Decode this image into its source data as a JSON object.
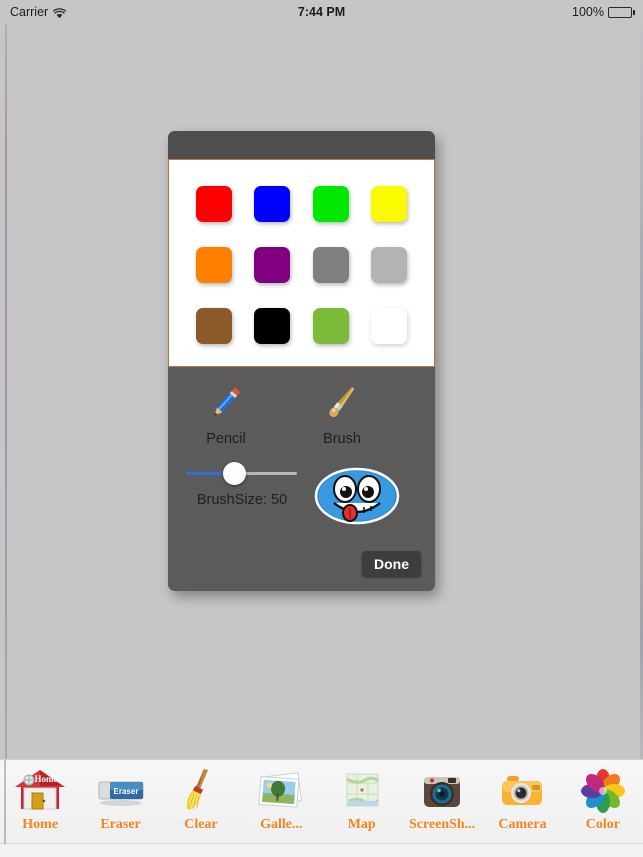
{
  "statusbar": {
    "carrier": "Carrier",
    "wifi_icon": "wifi-icon",
    "time": "7:44 PM",
    "battery_percent": "100%",
    "battery_icon": "battery-full-icon"
  },
  "modal": {
    "title": "",
    "palette": {
      "rows": 3,
      "cols": 4,
      "swatches": [
        {
          "name": "red",
          "hex": "#FF0000"
        },
        {
          "name": "blue",
          "hex": "#0000FF"
        },
        {
          "name": "green",
          "hex": "#00E800"
        },
        {
          "name": "yellow",
          "hex": "#FAFA00"
        },
        {
          "name": "orange",
          "hex": "#FF7F00"
        },
        {
          "name": "purple",
          "hex": "#800080"
        },
        {
          "name": "dark-gray",
          "hex": "#808080"
        },
        {
          "name": "light-gray",
          "hex": "#B3B3B3"
        },
        {
          "name": "brown",
          "hex": "#8B5A2B"
        },
        {
          "name": "black",
          "hex": "#000000"
        },
        {
          "name": "yellow-green",
          "hex": "#7CBB3A"
        },
        {
          "name": "white",
          "hex": "#FFFFFF"
        }
      ],
      "border_color": "#C8723A"
    },
    "tools": [
      {
        "name": "pencil",
        "label": "Pencil",
        "icon": "pencil-icon"
      },
      {
        "name": "brush",
        "label": "Brush",
        "icon": "brush-icon"
      }
    ],
    "slider": {
      "label": "BrushSize: 50",
      "value": 50,
      "min": 0,
      "max": 100,
      "fill_color": "#2F6FD0",
      "track_color": "#B7B7B7"
    },
    "stamp": {
      "name": "blue-smiley-stamp",
      "icon": "smiley-face-icon"
    },
    "done_label": "Done"
  },
  "toolbar": {
    "items": [
      {
        "name": "home",
        "label": "Home",
        "icon": "home-icon"
      },
      {
        "name": "eraser",
        "label": "Eraser",
        "icon": "eraser-icon"
      },
      {
        "name": "clear",
        "label": "Clear",
        "icon": "broom-icon"
      },
      {
        "name": "gallery",
        "label": "Galle...",
        "icon": "photos-icon"
      },
      {
        "name": "map",
        "label": "Map",
        "icon": "map-icon"
      },
      {
        "name": "screenshot",
        "label": "ScreenSh...",
        "icon": "retro-camera-icon"
      },
      {
        "name": "camera",
        "label": "Camera",
        "icon": "camera-icon"
      },
      {
        "name": "color",
        "label": "Color",
        "icon": "color-wheel-icon"
      }
    ],
    "label_color": "#F2861E"
  }
}
